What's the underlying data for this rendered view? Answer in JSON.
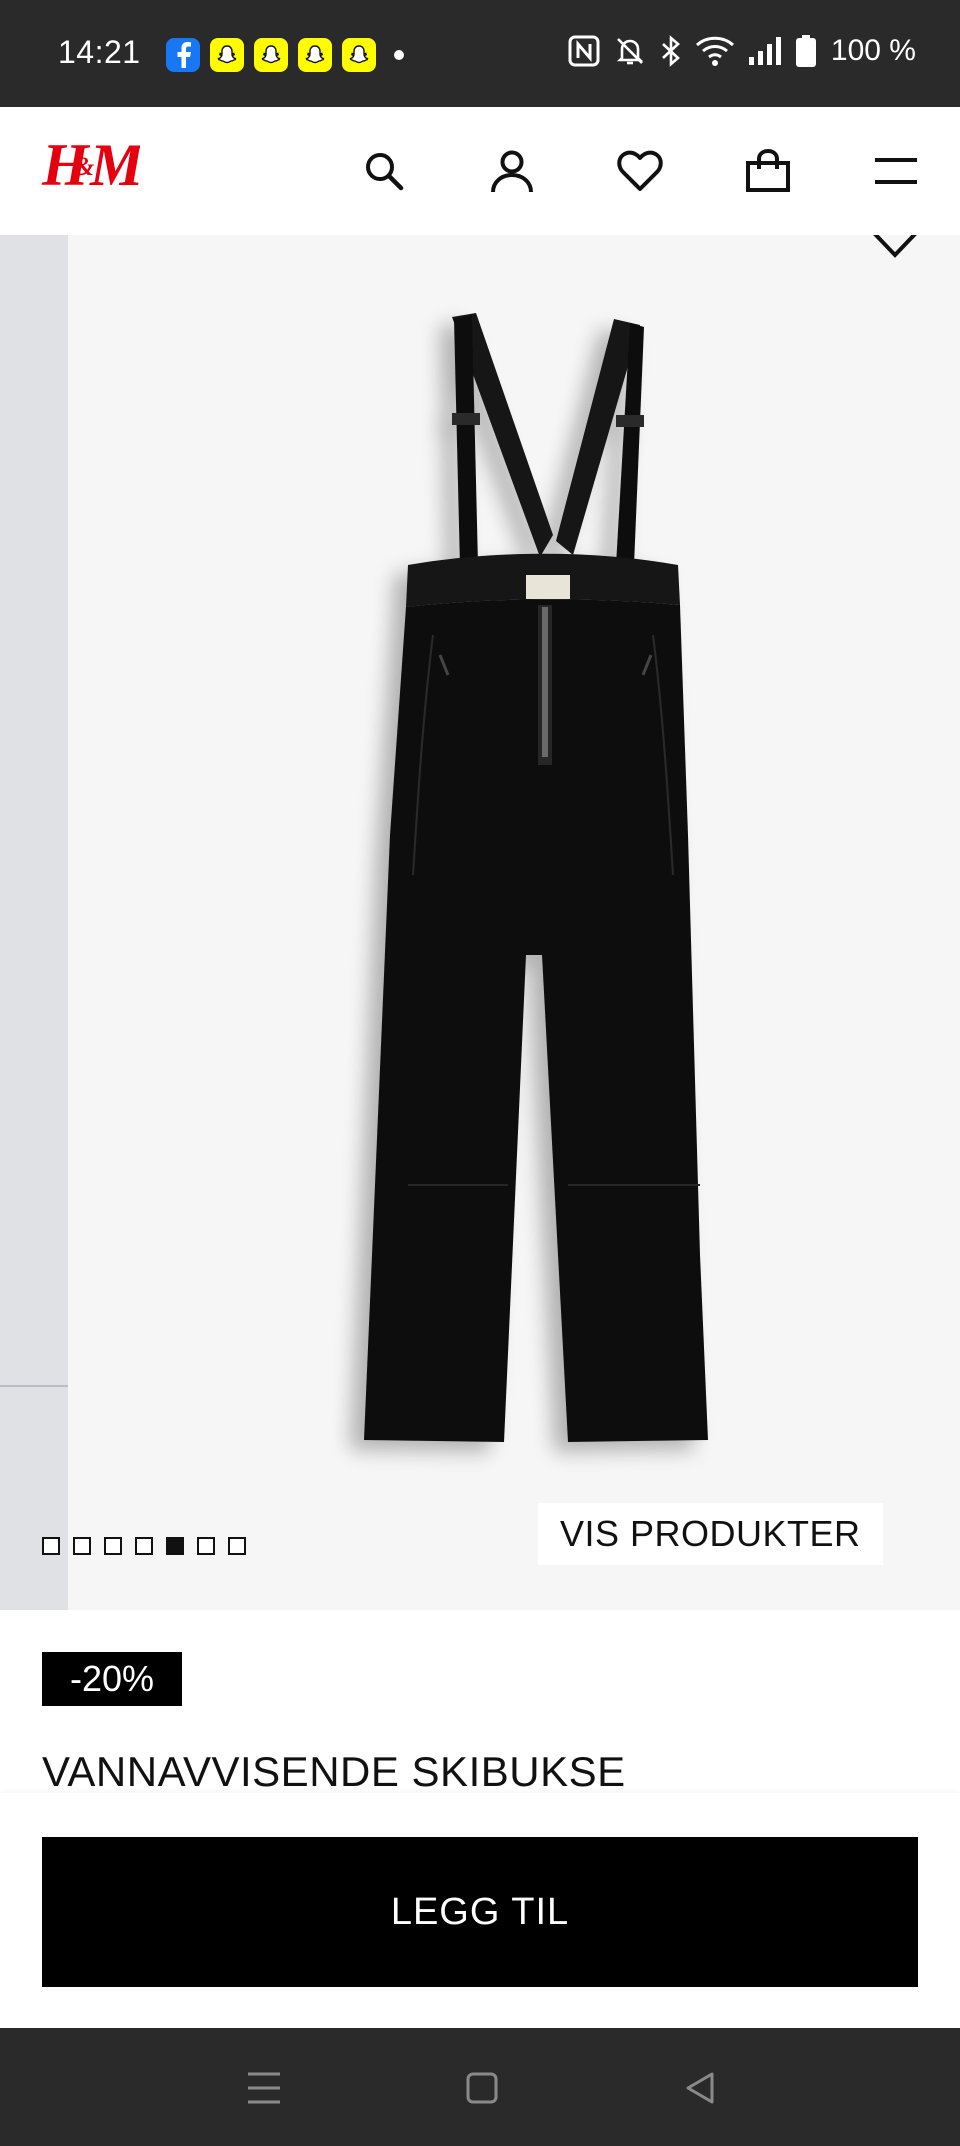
{
  "status_bar": {
    "time": "14:21",
    "battery": "100 %",
    "app_icons": [
      "facebook-icon",
      "snapchat-icon",
      "snapchat-icon",
      "snapchat-icon",
      "snapchat-icon"
    ],
    "system_icons": [
      "nfc-icon",
      "bell-muted-icon",
      "bluetooth-icon",
      "wifi-icon",
      "signal-icon",
      "battery-icon"
    ]
  },
  "header": {
    "brand": "H&M",
    "icons": [
      "search-icon",
      "account-icon",
      "favorites-icon",
      "cart-icon",
      "menu-icon"
    ]
  },
  "gallery": {
    "image_count": 7,
    "active_index": 4,
    "show_products_label": "VIS PRODUKTER"
  },
  "product": {
    "discount_badge": "-20%",
    "name": "VANNAVVISENDE SKIBUKSE"
  },
  "actions": {
    "add_label": "LEGG TIL"
  },
  "nav_bar": {
    "icons": [
      "recent-apps-icon",
      "home-icon",
      "back-icon"
    ]
  },
  "colors": {
    "brand_red": "#e50010",
    "status_bar": "#2a2a2a",
    "button": "#000000"
  }
}
